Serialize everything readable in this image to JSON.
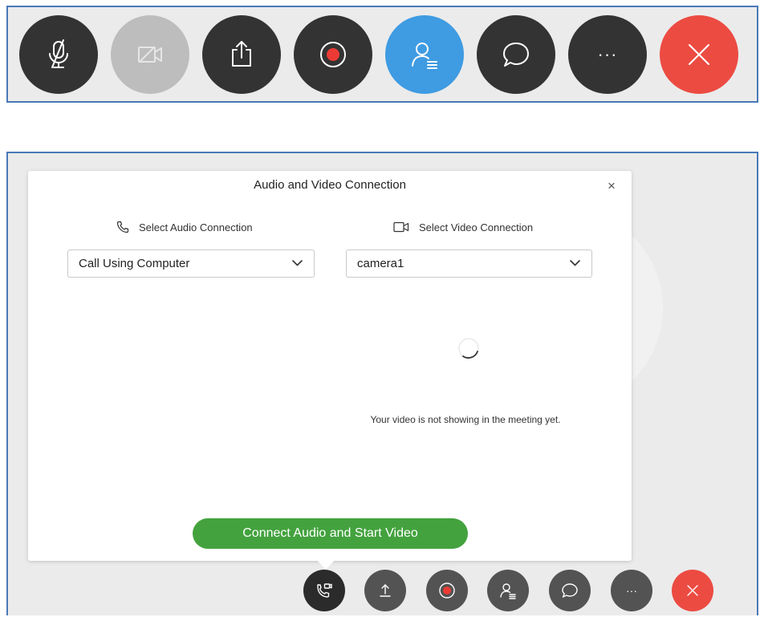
{
  "top_toolbar": {
    "buttons": [
      {
        "name": "mute-button",
        "icon": "microphone-muted-icon",
        "color": "#333333"
      },
      {
        "name": "video-button",
        "icon": "video-off-icon",
        "color": "#bdbdbd"
      },
      {
        "name": "share-button",
        "icon": "share-icon",
        "color": "#333333"
      },
      {
        "name": "record-button",
        "icon": "record-icon",
        "color": "#333333"
      },
      {
        "name": "participants-button",
        "icon": "participants-icon",
        "color": "#3f9be2"
      },
      {
        "name": "chat-button",
        "icon": "chat-icon",
        "color": "#333333"
      },
      {
        "name": "more-button",
        "icon": "more-icon",
        "color": "#333333"
      },
      {
        "name": "leave-button",
        "icon": "close-icon",
        "color": "#ec4b42"
      }
    ],
    "more_label": "···"
  },
  "dialog": {
    "title": "Audio and Video Connection",
    "close_label": "×",
    "audio": {
      "label": "Select Audio Connection",
      "icon": "phone-icon",
      "selected": "Call Using Computer"
    },
    "video": {
      "label": "Select Video Connection",
      "icon": "camera-icon",
      "selected": "camera1"
    },
    "video_status": "Your video is not showing in the meeting yet.",
    "connect_label": "Connect Audio and Start Video",
    "connect_color": "#43a23e"
  },
  "bottom_toolbar": {
    "buttons": [
      {
        "name": "audio-connection-button",
        "icon": "phone-video-icon",
        "color": "#2b2b2b"
      },
      {
        "name": "share-button",
        "icon": "upload-icon",
        "color": "#535353"
      },
      {
        "name": "record-button",
        "icon": "record-icon",
        "color": "#535353"
      },
      {
        "name": "participants-button",
        "icon": "participants-icon",
        "color": "#535353"
      },
      {
        "name": "chat-button",
        "icon": "chat-icon",
        "color": "#535353"
      },
      {
        "name": "more-button",
        "icon": "more-icon",
        "color": "#535353"
      },
      {
        "name": "leave-button",
        "icon": "close-icon",
        "color": "#ec4b42"
      }
    ],
    "more_label": "···"
  }
}
